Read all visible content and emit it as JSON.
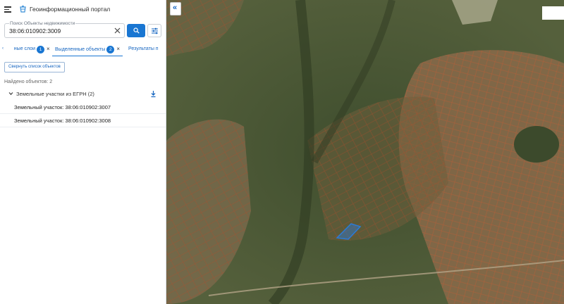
{
  "app": {
    "title": "Геоинформационный портал",
    "menu_icon": "hamburger-icon",
    "logo_icon": "globe-logo-icon"
  },
  "search": {
    "label": "Поиск Объекты недвижимости",
    "value": "38:06:010902:3009",
    "clear_icon": "close-icon",
    "search_icon": "search-icon",
    "filter_icon": "filter-sliders-icon"
  },
  "tabs": [
    {
      "label": "ные слои",
      "badge": "1"
    },
    {
      "label": "Выделенные объекты",
      "badge": "2"
    },
    {
      "label": "Результаты п"
    }
  ],
  "panel": {
    "collapse_list_label": "Свернуть список объектов",
    "found_text": "Найдено объектов: 2",
    "group_label": "Земельные участки из ЕГРН (2)",
    "items": [
      {
        "label": "Земельный участок: 38:06:010902:3007"
      },
      {
        "label": "Земельный участок: 38:06:010902:3008"
      }
    ]
  },
  "map": {
    "collapse_icon": "double-chevron-left-icon",
    "highlight_color": "#2b7bd8",
    "parcel_line_color": "#c8552e"
  }
}
